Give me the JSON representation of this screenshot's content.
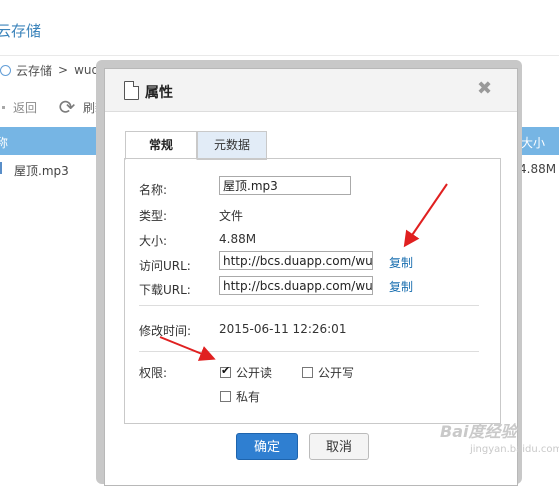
{
  "app": {
    "title": "云存储"
  },
  "breadcrumb": {
    "root": "云存储",
    "separator": ">",
    "current": "wuding"
  },
  "toolbar": {
    "back_label": "返回",
    "refresh_label": "刷新"
  },
  "table": {
    "headers": [
      "称",
      "大小"
    ],
    "rows": [
      {
        "name": "屋顶.mp3",
        "size": "4.88M"
      }
    ]
  },
  "dialog": {
    "title": "属性",
    "close_label": "✖",
    "tabs": [
      {
        "label": "常规",
        "active": true
      },
      {
        "label": "元数据",
        "active": false
      }
    ],
    "fields": {
      "name_label": "名称:",
      "name_value": "屋顶.mp3",
      "type_label": "类型:",
      "type_value": "文件",
      "size_label": "大小:",
      "size_value": "4.88M",
      "access_url_label": "访问URL:",
      "access_url_value": "http://bcs.duapp.com/wuding",
      "download_url_label": "下载URL:",
      "download_url_value": "http://bcs.duapp.com/wuding",
      "copy_label": "复制",
      "modified_label": "修改时间:",
      "modified_value": "2015-06-11 12:26:01",
      "permission_label": "权限:"
    },
    "permissions": {
      "public_read": {
        "label": "公开读",
        "checked": true
      },
      "public_write": {
        "label": "公开写",
        "checked": false
      },
      "private": {
        "label": "私有",
        "checked": false
      }
    },
    "buttons": {
      "ok": "确定",
      "cancel": "取消"
    }
  },
  "watermark": {
    "text": "Bai度经验",
    "url": "jingyan.baidu.com"
  },
  "colors": {
    "accent": "#2f7fd1",
    "link": "#1a6fb0",
    "header_blue": "#5ea8e0",
    "annotation_red": "#e02020"
  }
}
